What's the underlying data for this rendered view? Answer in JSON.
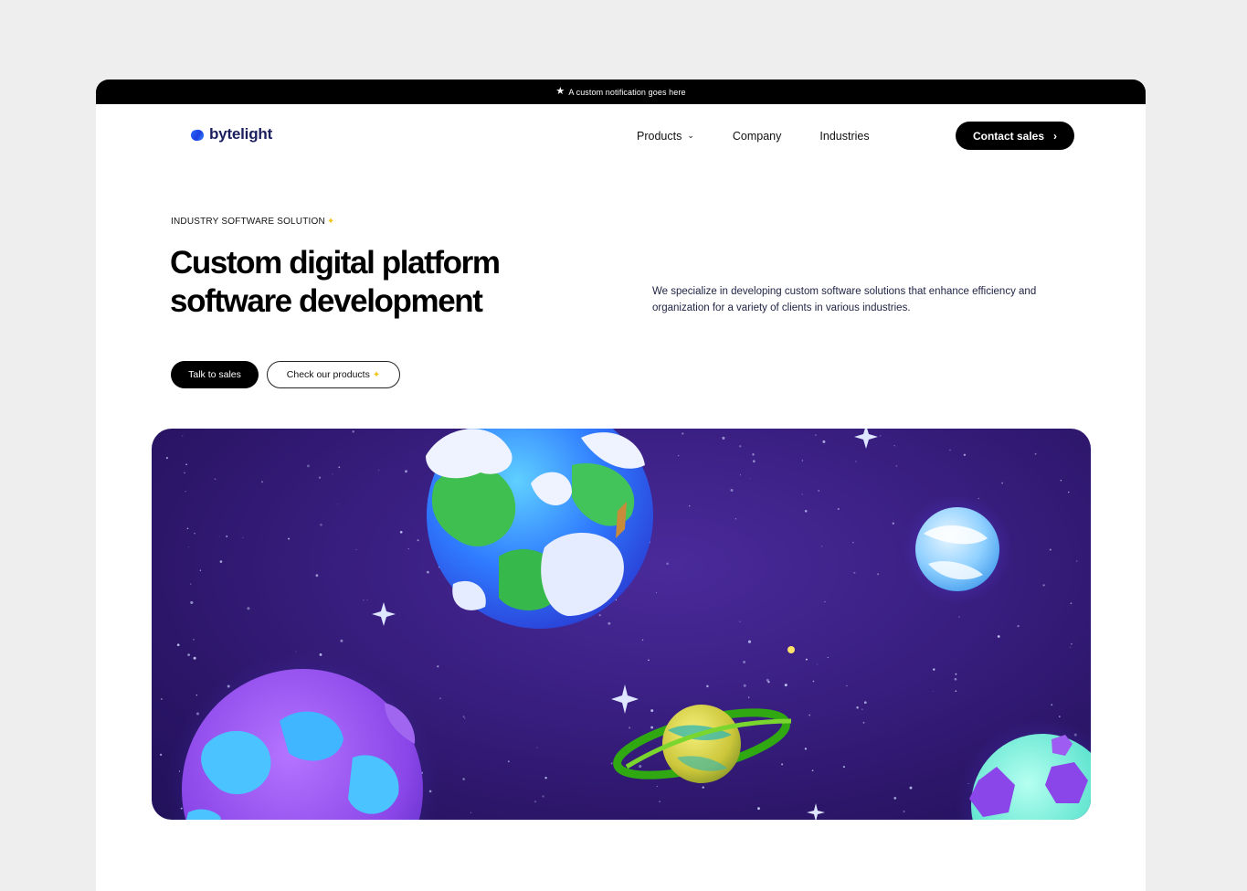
{
  "notification": {
    "icon": "star-icon",
    "text": "A custom notification goes here"
  },
  "brand": {
    "name": "bytelight",
    "logo_color": "#2c6bff"
  },
  "nav": {
    "items": [
      {
        "label": "Products",
        "has_dropdown": true
      },
      {
        "label": "Company"
      },
      {
        "label": "Industries"
      }
    ],
    "cta_label": "Contact sales",
    "cta_icon": "chevron-right-icon"
  },
  "hero": {
    "eyebrow": "INDUSTRY SOFTWARE SOLUTION",
    "eyebrow_icon": "sparkle-icon",
    "title_line1": "Custom digital platform",
    "title_line2": "software development",
    "description": "We specialize in developing custom software solutions that enhance efficiency and organization for a variety of clients in various industries.",
    "primary_button": "Talk to sales",
    "secondary_button": "Check our products",
    "secondary_icon": "sparkle-icon",
    "illustration": "space-planets-illustration"
  },
  "colors": {
    "accent": "#000000",
    "brand": "#1b1f5e",
    "hero_bg": "#3a1f82"
  }
}
